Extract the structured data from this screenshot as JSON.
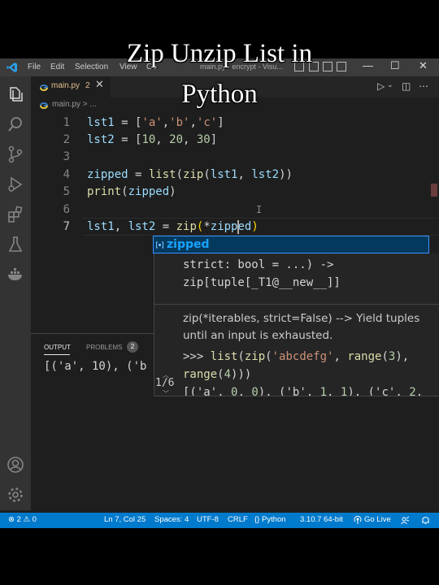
{
  "caption": {
    "line1": "Zip Unzip List in",
    "line2": "Python"
  },
  "titlebar": {
    "menu": [
      "File",
      "Edit",
      "Selection",
      "View",
      "Go"
    ],
    "window_title": "main.py - encrypt - Visu...",
    "controls": {
      "minimize": "—",
      "maximize": "☐",
      "close": "✕"
    }
  },
  "activity_bar": {
    "top": [
      "files-icon",
      "search-icon",
      "source-control-icon",
      "run-debug-icon",
      "extensions-icon",
      "testing-icon",
      "docker-icon"
    ],
    "bottom": [
      "account-icon",
      "settings-gear-icon"
    ]
  },
  "tab": {
    "name": "main.py",
    "problem_count": "2",
    "close": "✕"
  },
  "editor_actions": {
    "run": "▷",
    "run_dropdown": "⌄",
    "split": "◫",
    "more": "⋯"
  },
  "breadcrumb": {
    "text": "main.py > ..."
  },
  "code": {
    "line_numbers": [
      "1",
      "2",
      "3",
      "4",
      "5",
      "6",
      "7"
    ],
    "line1": {
      "a": "lst1",
      "b": " = [",
      "c": "'a'",
      "d": ",",
      "e": "'b'",
      "f": ",",
      "g": "'c'",
      "h": "]"
    },
    "line2": {
      "a": "lst2",
      "b": " = [",
      "c": "10",
      "d": ", ",
      "e": "20",
      "f": ", ",
      "g": "30",
      "h": "]"
    },
    "line4": {
      "a": "zipped",
      "b": " = ",
      "c": "list",
      "d": "(",
      "e": "zip",
      "f": "(",
      "g": "lst1",
      "h": ", ",
      "i": "lst2",
      "j": "))"
    },
    "line5": {
      "a": "print",
      "b": "(",
      "c": "zipped",
      "d": ")"
    },
    "line7": {
      "a": "lst1",
      "b": ", ",
      "c": "lst2",
      "d": " = ",
      "e": "zip",
      "f": "(",
      "g": "*",
      "h": "zipped",
      "i": ")"
    }
  },
  "suggest": {
    "icon": "variable-icon",
    "label": "zipped"
  },
  "details": {
    "signature_1": "strict: bool = ...) ->",
    "signature_2": "zip[tuple[_T1@__new__]]",
    "doc_1": "zip(*iterables, strict=False) --> Yield tuples",
    "doc_2": "until an input is exhausted.",
    "ex1": {
      "a": ">>> ",
      "b": "list",
      "c": "(",
      "d": "zip",
      "e": "(",
      "f": "'abcdefg'",
      "g": ", ",
      "h": "range",
      "i": "(",
      "j": "3",
      "k": "),"
    },
    "ex2": {
      "a": "range",
      "b": "(",
      "c": "4",
      "d": ")))"
    },
    "ex3": {
      "a": "[('a', ",
      "b": "0",
      "c": ", ",
      "d": "0",
      "e": "), ('b', ",
      "f": "1",
      "g": ", ",
      "h": "1",
      "i": "), ('c', ",
      "j": "2",
      "k": ","
    },
    "pager": "1/6"
  },
  "panel": {
    "tabs": [
      "OUTPUT",
      "PROBLEMS"
    ],
    "problems_badge": "2",
    "output_line": "[('a', 10), ('b"
  },
  "statusbar": {
    "problems": "⊗ 2 ⚠ 0",
    "position": "Ln 7, Col 25",
    "spaces": "Spaces: 4",
    "encoding": "UTF-8",
    "eol": "CRLF",
    "language": "{} Python",
    "interpreter": "3.10.7 64-bit",
    "golive": "Go Live"
  },
  "colors": {
    "statusbar": "#007acc",
    "editor_bg": "#1e1e1e",
    "suggest_highlight": "#04395e",
    "accent": "#3794ff"
  }
}
